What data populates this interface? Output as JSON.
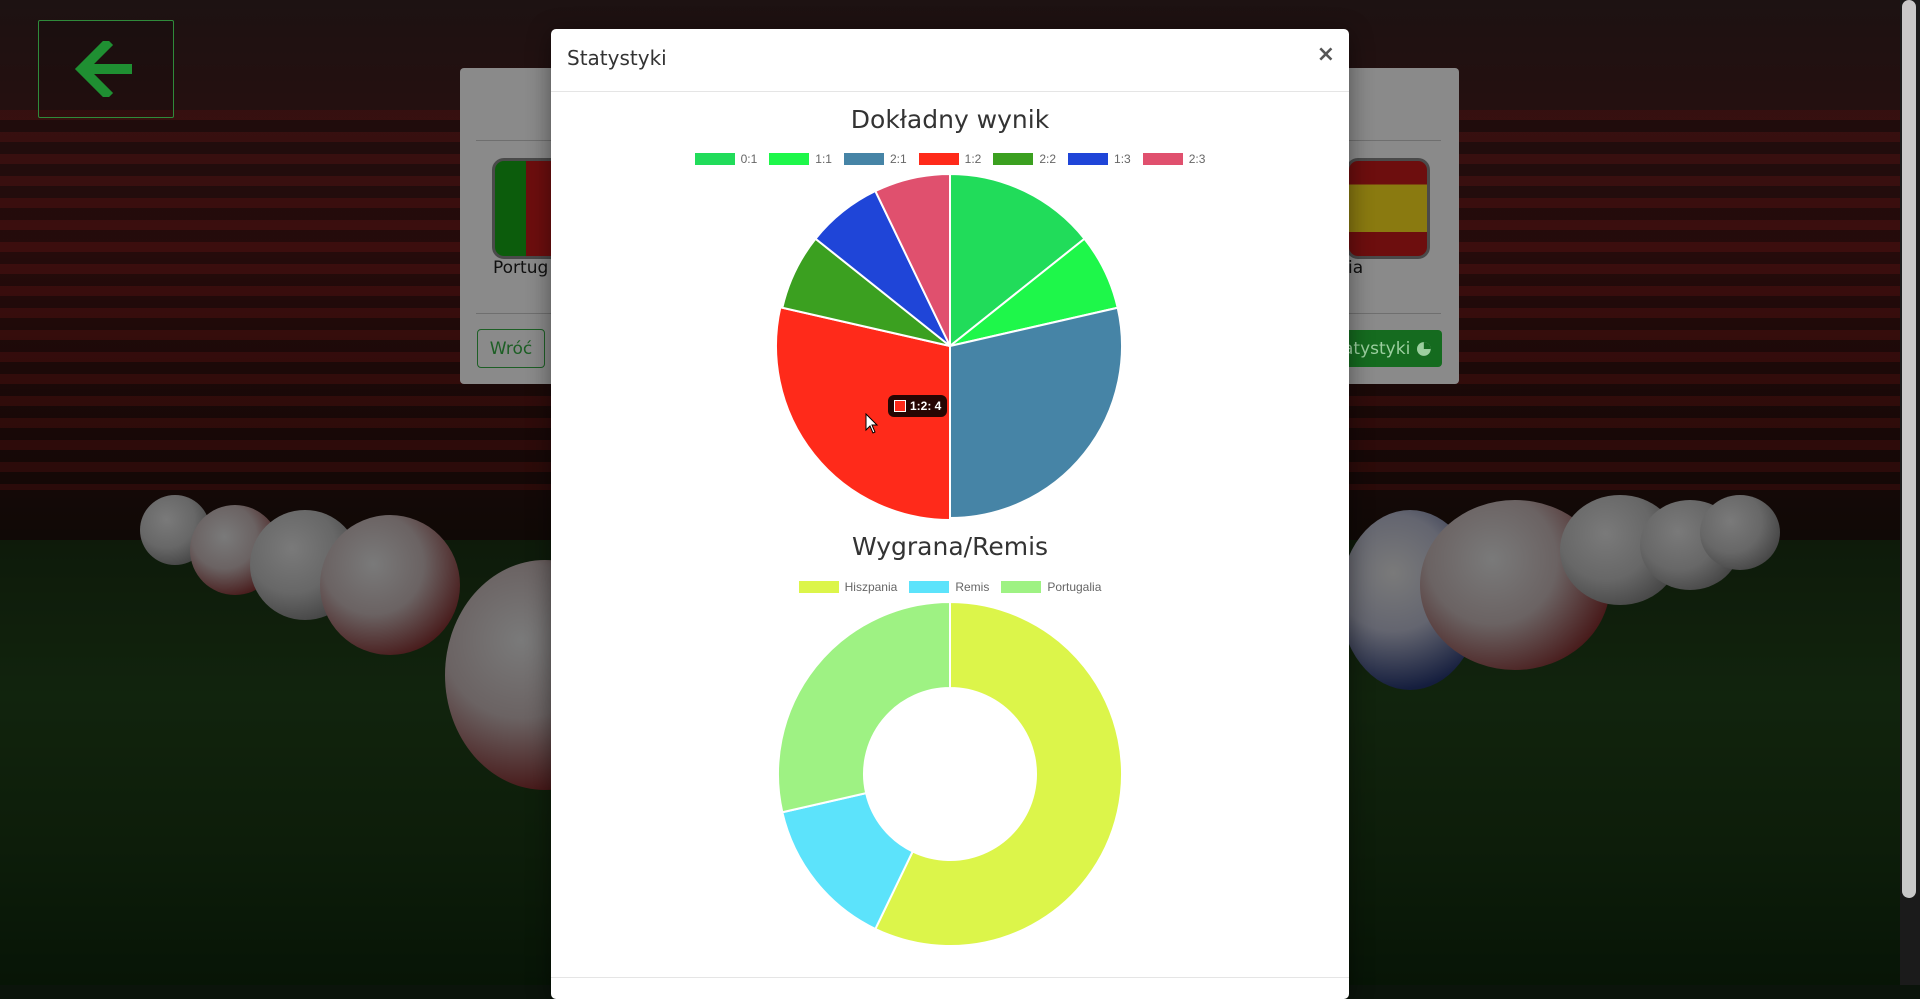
{
  "background_page": {
    "back_icon": "arrow-left-icon",
    "team_home": "Portugalia",
    "team_home_visible": "Portug",
    "team_away_visible": "ia",
    "back_button_label": "Wróć",
    "stats_button_label": "atystyki",
    "stats_button_icon": "pie-chart-icon"
  },
  "modal": {
    "title": "Statystyki",
    "close_label": "×"
  },
  "tooltip": {
    "text": "1:2: 4",
    "color": "#ff2a1a"
  },
  "chart_data": [
    {
      "type": "pie",
      "title": "Dokładny wynik",
      "legend": "top",
      "categories": [
        "0:1",
        "1:1",
        "2:1",
        "1:2",
        "2:2",
        "1:3",
        "2:3"
      ],
      "values": [
        2,
        1,
        4,
        4,
        1,
        1,
        1
      ],
      "colors": [
        "#21dc5a",
        "#1ef74a",
        "#4684a6",
        "#ff2a1a",
        "#3ba020",
        "#1f45d8",
        "#e0506e"
      ]
    },
    {
      "type": "doughnut",
      "title": "Wygrana/Remis",
      "legend": "top",
      "categories": [
        "Hiszpania",
        "Remis",
        "Portugalia"
      ],
      "values": [
        8,
        2,
        4
      ],
      "colors": [
        "#dcf54a",
        "#5ce3fb",
        "#9ef283"
      ]
    }
  ]
}
